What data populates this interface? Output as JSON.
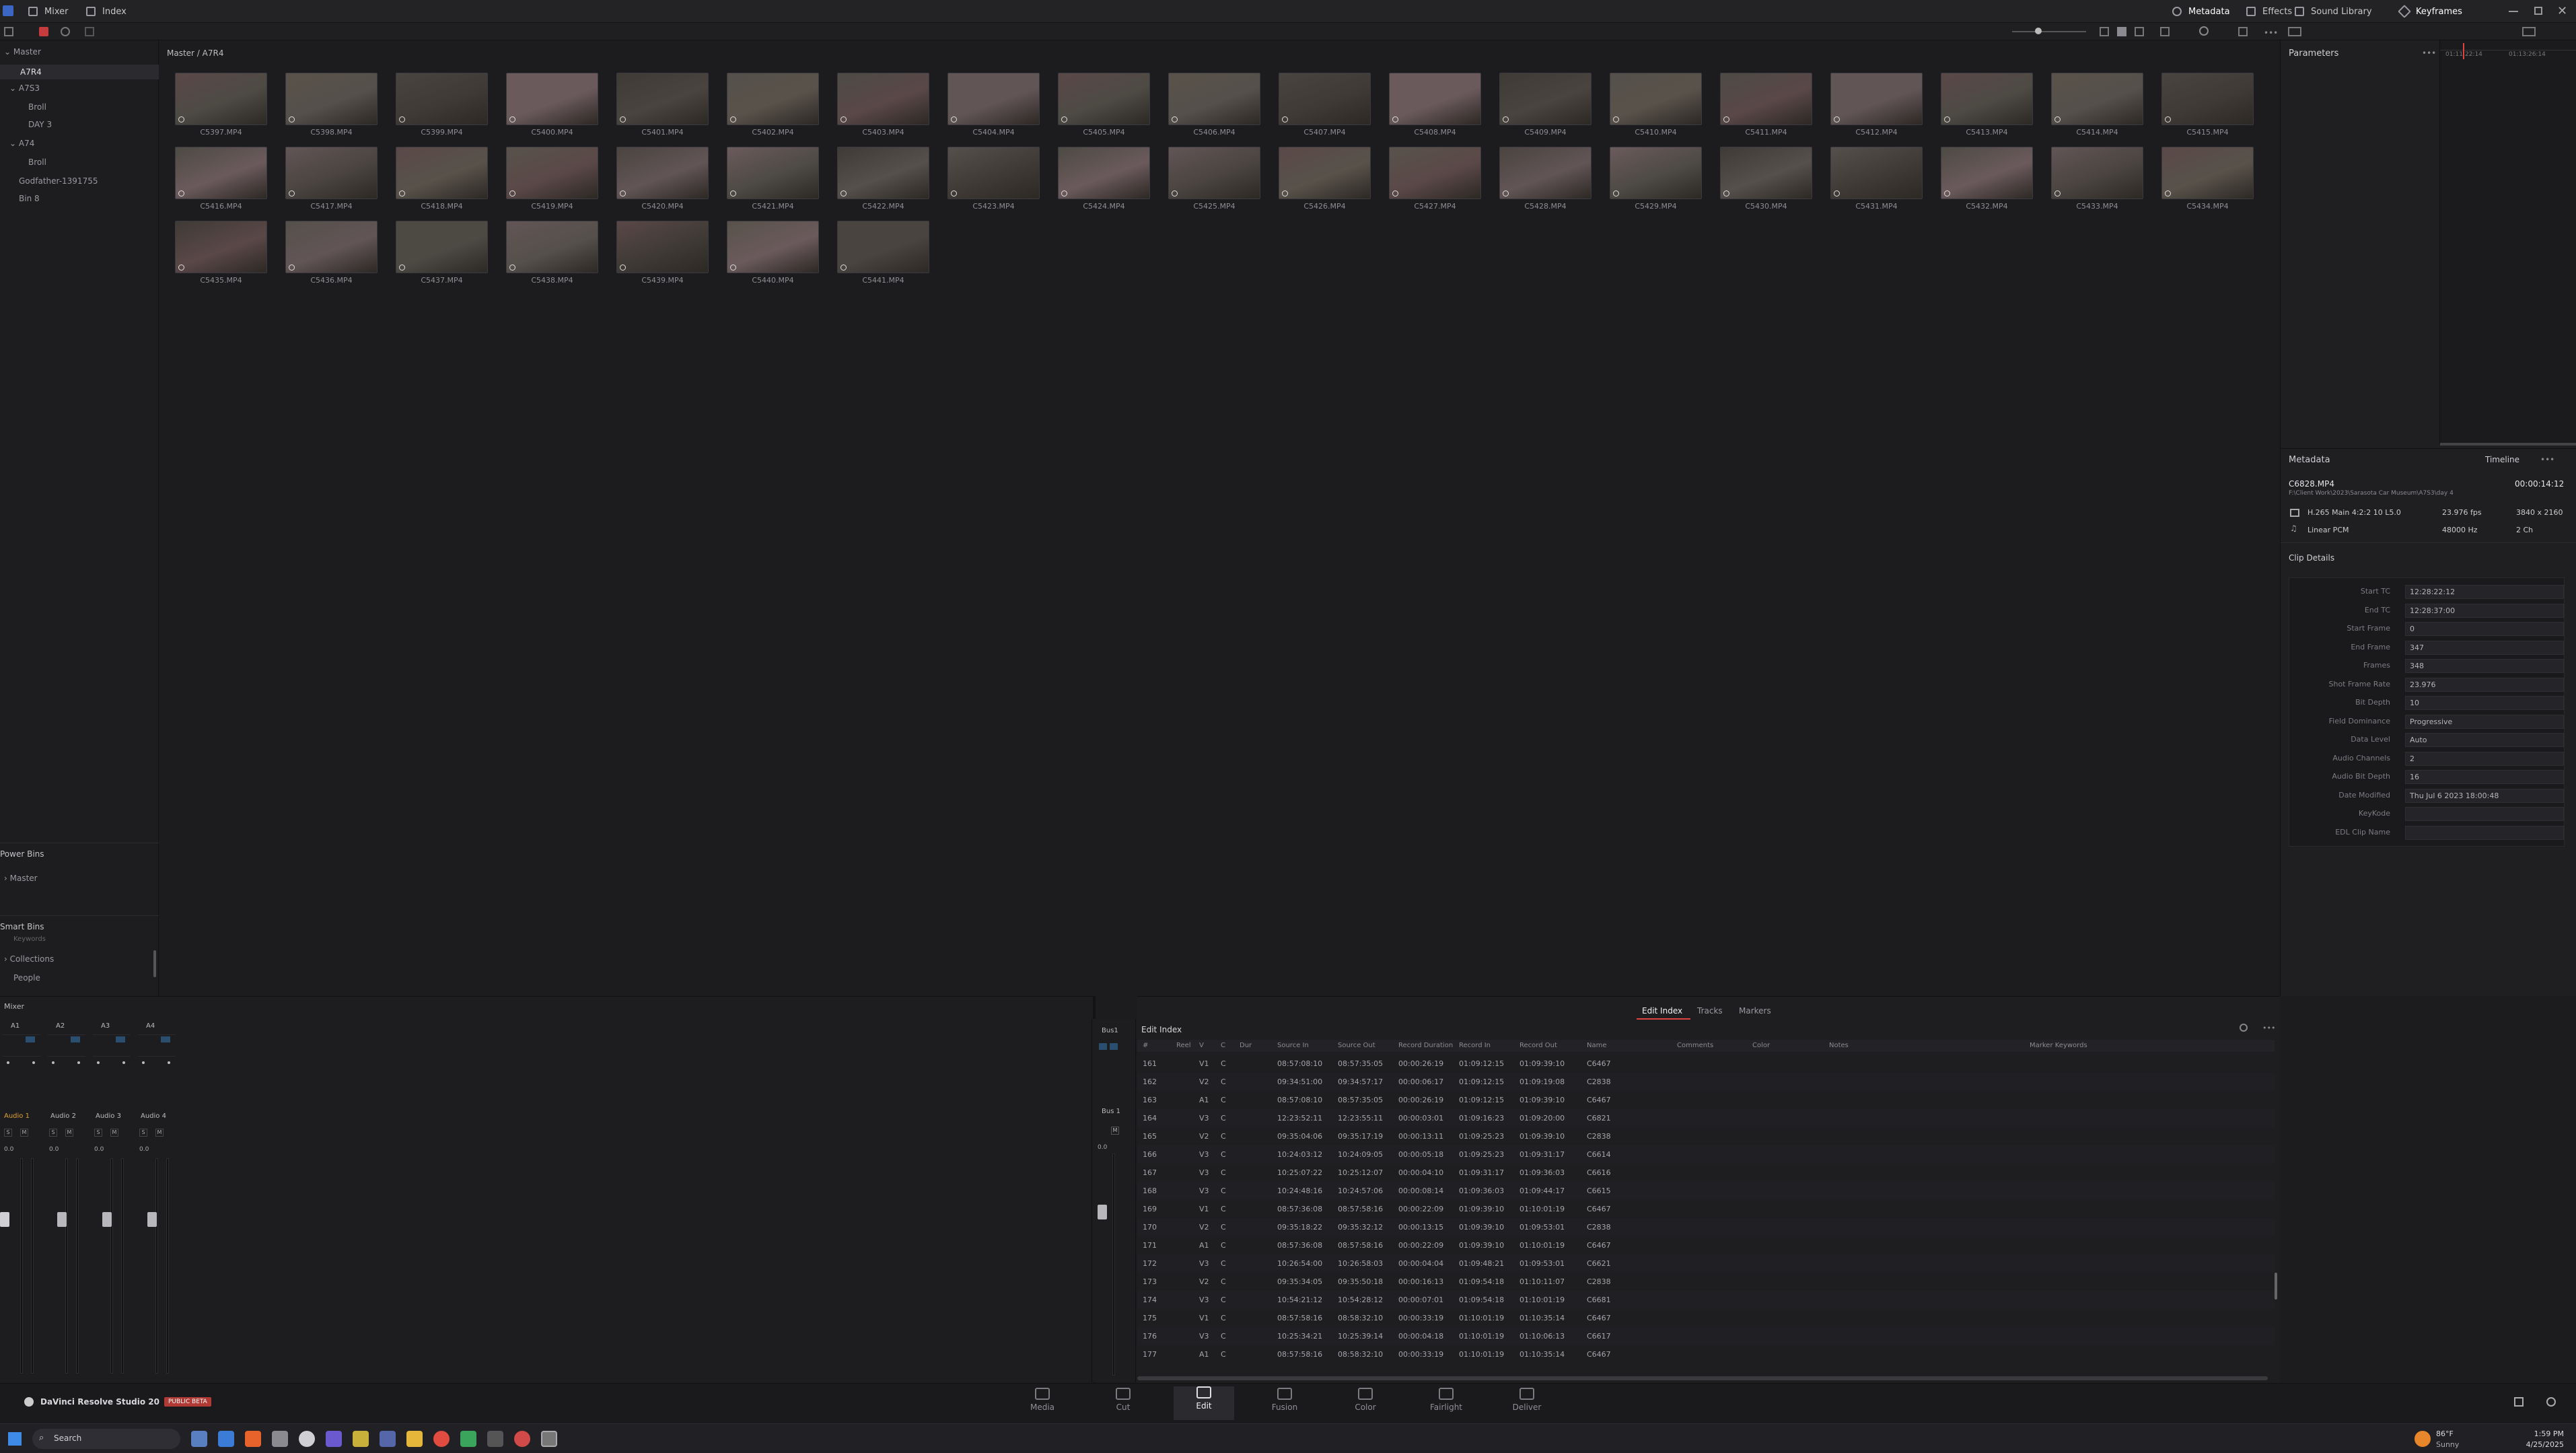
{
  "topbar": {
    "mixer_label": "Mixer",
    "index_label": "Index",
    "metadata_label": "Metadata",
    "effects_label": "Effects",
    "sound_library_label": "Sound Library",
    "keyframes_label": "Keyframes"
  },
  "sidebar": {
    "master_header": "Master",
    "items": [
      {
        "label": "A7R4",
        "selected": true
      },
      {
        "label": "A7S3"
      },
      {
        "label": "Broll"
      },
      {
        "label": "DAY 3"
      },
      {
        "label": "A74"
      },
      {
        "label": "Broll"
      },
      {
        "label": "Godfather-1391755"
      },
      {
        "label": "Bin 8"
      }
    ],
    "power_bins_header": "Power Bins",
    "power_bins_master": "Master",
    "smart_bins_header": "Smart Bins",
    "smart_bins": [
      "Keywords",
      "Collections",
      "People"
    ]
  },
  "media_pool": {
    "breadcrumb": "Master / A7R4",
    "clips": [
      "C5397.MP4",
      "C5398.MP4",
      "C5399.MP4",
      "C5400.MP4",
      "C5401.MP4",
      "C5402.MP4",
      "C5403.MP4",
      "C5404.MP4",
      "C5405.MP4",
      "C5406.MP4",
      "C5407.MP4",
      "C5408.MP4",
      "C5409.MP4",
      "C5410.MP4",
      "C5411.MP4",
      "C5412.MP4",
      "C5413.MP4",
      "C5414.MP4",
      "C5415.MP4",
      "C5416.MP4",
      "C5417.MP4",
      "C5418.MP4",
      "C5419.MP4",
      "C5420.MP4",
      "C5421.MP4",
      "C5422.MP4",
      "C5423.MP4",
      "C5424.MP4",
      "C5425.MP4",
      "C5426.MP4",
      "C5427.MP4",
      "C5428.MP4",
      "C5429.MP4",
      "C5430.MP4",
      "C5431.MP4",
      "C5432.MP4",
      "C5433.MP4",
      "C5434.MP4",
      "C5435.MP4",
      "C5436.MP4",
      "C5437.MP4",
      "C5438.MP4",
      "C5439.MP4",
      "C5440.MP4",
      "C5441.MP4"
    ]
  },
  "parameters": {
    "title": "Parameters"
  },
  "timecode_ruler": [
    "01:11:22:14",
    "01:13:26:14"
  ],
  "metadata": {
    "title": "Metadata",
    "timeline_tab": "Timeline",
    "clip_name": "C6828.MP4",
    "clip_path": "F:\\Client Work\\2023\\Sarasota Car Museum\\A7S3\\day 4",
    "duration": "00:00:14:12",
    "codec": "H.265 Main 4:2:2 10 L5.0",
    "fps": "23.976 fps",
    "resolution": "3840 x 2160",
    "audio_codec": "Linear PCM",
    "audio_rate": "48000 Hz",
    "audio_channels": "2 Ch",
    "clip_details_title": "Clip Details",
    "details": [
      {
        "k": "Start TC",
        "v": "12:28:22:12"
      },
      {
        "k": "End TC",
        "v": "12:28:37:00"
      },
      {
        "k": "Start Frame",
        "v": "0"
      },
      {
        "k": "End Frame",
        "v": "347"
      },
      {
        "k": "Frames",
        "v": "348"
      },
      {
        "k": "Shot Frame Rate",
        "v": "23.976"
      },
      {
        "k": "Bit Depth",
        "v": "10"
      },
      {
        "k": "Field Dominance",
        "v": "Progressive"
      },
      {
        "k": "Data Level",
        "v": "Auto"
      },
      {
        "k": "Audio Channels",
        "v": "2"
      },
      {
        "k": "Audio Bit Depth",
        "v": "16"
      },
      {
        "k": "Date Modified",
        "v": "Thu Jul 6 2023 18:00:48"
      },
      {
        "k": "KeyKode",
        "v": ""
      },
      {
        "k": "EDL Clip Name",
        "v": ""
      }
    ]
  },
  "mixer": {
    "title": "Mixer",
    "channels": [
      "A1",
      "A2",
      "A3",
      "A4"
    ],
    "track_names": [
      "Audio 1",
      "Audio 2",
      "Audio 3",
      "Audio 4"
    ],
    "bus_label": "Bus1",
    "bus_name": "Bus 1",
    "value": "0.0"
  },
  "edit_index": {
    "title": "Edit Index",
    "tabs": [
      "Edit Index",
      "Tracks",
      "Markers"
    ],
    "columns": [
      "#",
      "Reel",
      "V",
      "C",
      "Dur",
      "Source In",
      "Source Out",
      "Record Duration",
      "Record In",
      "Record Out",
      "Name",
      "Comments",
      "Color",
      "Notes",
      "Marker Keywords"
    ],
    "rows": [
      [
        "161",
        "V1",
        "C",
        "08:57:08:10",
        "08:57:35:05",
        "00:00:26:19",
        "01:09:12:15",
        "01:09:39:10",
        "C6467"
      ],
      [
        "162",
        "V2",
        "C",
        "09:34:51:00",
        "09:34:57:17",
        "00:00:06:17",
        "01:09:12:15",
        "01:09:19:08",
        "C2838"
      ],
      [
        "163",
        "A1",
        "C",
        "08:57:08:10",
        "08:57:35:05",
        "00:00:26:19",
        "01:09:12:15",
        "01:09:39:10",
        "C6467"
      ],
      [
        "164",
        "V3",
        "C",
        "12:23:52:11",
        "12:23:55:11",
        "00:00:03:01",
        "01:09:16:23",
        "01:09:20:00",
        "C6821"
      ],
      [
        "165",
        "V2",
        "C",
        "09:35:04:06",
        "09:35:17:19",
        "00:00:13:11",
        "01:09:25:23",
        "01:09:39:10",
        "C2838"
      ],
      [
        "166",
        "V3",
        "C",
        "10:24:03:12",
        "10:24:09:05",
        "00:00:05:18",
        "01:09:25:23",
        "01:09:31:17",
        "C6614"
      ],
      [
        "167",
        "V3",
        "C",
        "10:25:07:22",
        "10:25:12:07",
        "00:00:04:10",
        "01:09:31:17",
        "01:09:36:03",
        "C6616"
      ],
      [
        "168",
        "V3",
        "C",
        "10:24:48:16",
        "10:24:57:06",
        "00:00:08:14",
        "01:09:36:03",
        "01:09:44:17",
        "C6615"
      ],
      [
        "169",
        "V1",
        "C",
        "08:57:36:08",
        "08:57:58:16",
        "00:00:22:09",
        "01:09:39:10",
        "01:10:01:19",
        "C6467"
      ],
      [
        "170",
        "V2",
        "C",
        "09:35:18:22",
        "09:35:32:12",
        "00:00:13:15",
        "01:09:39:10",
        "01:09:53:01",
        "C2838"
      ],
      [
        "171",
        "A1",
        "C",
        "08:57:36:08",
        "08:57:58:16",
        "00:00:22:09",
        "01:09:39:10",
        "01:10:01:19",
        "C6467"
      ],
      [
        "172",
        "V3",
        "C",
        "10:26:54:00",
        "10:26:58:03",
        "00:00:04:04",
        "01:09:48:21",
        "01:09:53:01",
        "C6621"
      ],
      [
        "173",
        "V2",
        "C",
        "09:35:34:05",
        "09:35:50:18",
        "00:00:16:13",
        "01:09:54:18",
        "01:10:11:07",
        "C2838"
      ],
      [
        "174",
        "V3",
        "C",
        "10:54:21:12",
        "10:54:28:12",
        "00:00:07:01",
        "01:09:54:18",
        "01:10:01:19",
        "C6681"
      ],
      [
        "175",
        "V1",
        "C",
        "08:57:58:16",
        "08:58:32:10",
        "00:00:33:19",
        "01:10:01:19",
        "01:10:35:14",
        "C6467"
      ],
      [
        "176",
        "V3",
        "C",
        "10:25:34:21",
        "10:25:39:14",
        "00:00:04:18",
        "01:10:01:19",
        "01:10:06:13",
        "C6617"
      ],
      [
        "177",
        "A1",
        "C",
        "08:57:58:16",
        "08:58:32:10",
        "00:00:33:19",
        "01:10:01:19",
        "01:10:35:14",
        "C6467"
      ]
    ]
  },
  "pages": [
    {
      "label": "Media"
    },
    {
      "label": "Cut"
    },
    {
      "label": "Edit",
      "active": true
    },
    {
      "label": "Fusion"
    },
    {
      "label": "Color"
    },
    {
      "label": "Fairlight"
    },
    {
      "label": "Deliver"
    }
  ],
  "app": {
    "name": "DaVinci Resolve Studio 20",
    "badge": "PUBLIC BETA"
  },
  "taskbar": {
    "search_placeholder": "Search",
    "weather_temp": "86°F",
    "weather_desc": "Sunny",
    "time": "1:59 PM",
    "date": "4/25/2025"
  },
  "colors": {
    "accent_red": "#e0443e",
    "active_tab_underline": "#e0443e",
    "thumb_tints": [
      "#5a4848",
      "#6b5a5c",
      "#4d4a44",
      "#58524a",
      "#3f3a36",
      "#625556",
      "#4a4440",
      "#55504b"
    ]
  }
}
